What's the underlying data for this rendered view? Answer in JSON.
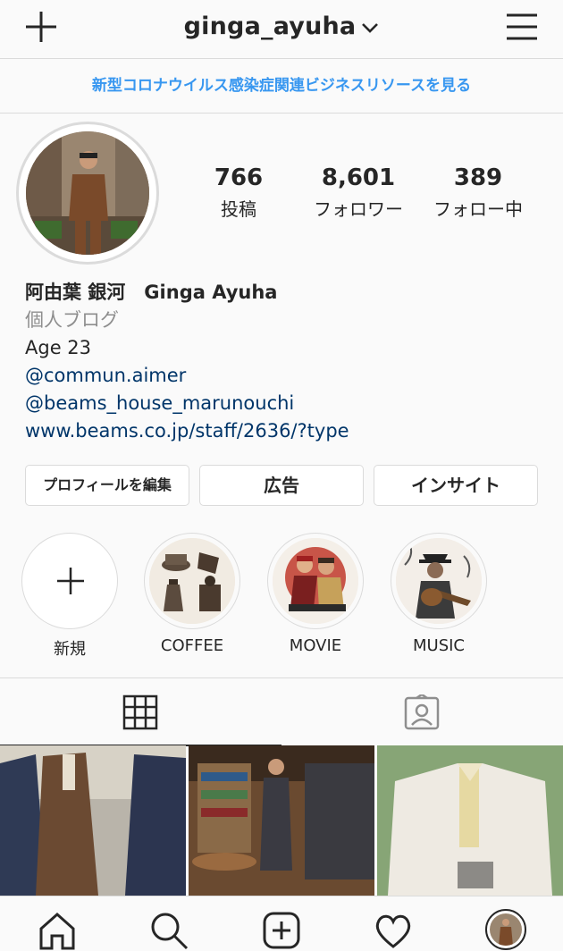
{
  "header": {
    "username": "ginga_ayuha",
    "icons": [
      "plus-icon",
      "chevron-down-icon",
      "menu-icon"
    ]
  },
  "banner": {
    "text": "新型コロナウイルス感染症関連ビジネスリソースを見る"
  },
  "stats": [
    {
      "value": "766",
      "label": "投稿"
    },
    {
      "value": "8,601",
      "label": "フォロワー"
    },
    {
      "value": "389",
      "label": "フォロー中"
    }
  ],
  "bio": {
    "name": "阿由葉 銀河　Ginga Ayuha",
    "category": "個人ブログ",
    "line1": "Age 23",
    "mention1": "@commun.aimer",
    "mention2": "@beams_house_marunouchi",
    "website": "www.beams.co.jp/staff/2636/?type"
  },
  "buttons": {
    "edit_profile": "プロフィールを編集",
    "ads": "広告",
    "insights": "インサイト"
  },
  "highlights": [
    {
      "label": "新規"
    },
    {
      "label": "COFFEE"
    },
    {
      "label": "MOVIE"
    },
    {
      "label": "MUSIC"
    }
  ],
  "tabs": [
    "grid-icon",
    "tagged-icon"
  ],
  "bottom_nav": [
    "home-icon",
    "search-icon",
    "new-post-icon",
    "activity-heart-icon",
    "profile-avatar"
  ],
  "colors": {
    "link_blue": "#3897f0",
    "bio_link": "#003569",
    "border": "#dbdbdb",
    "background": "#fafafa"
  }
}
